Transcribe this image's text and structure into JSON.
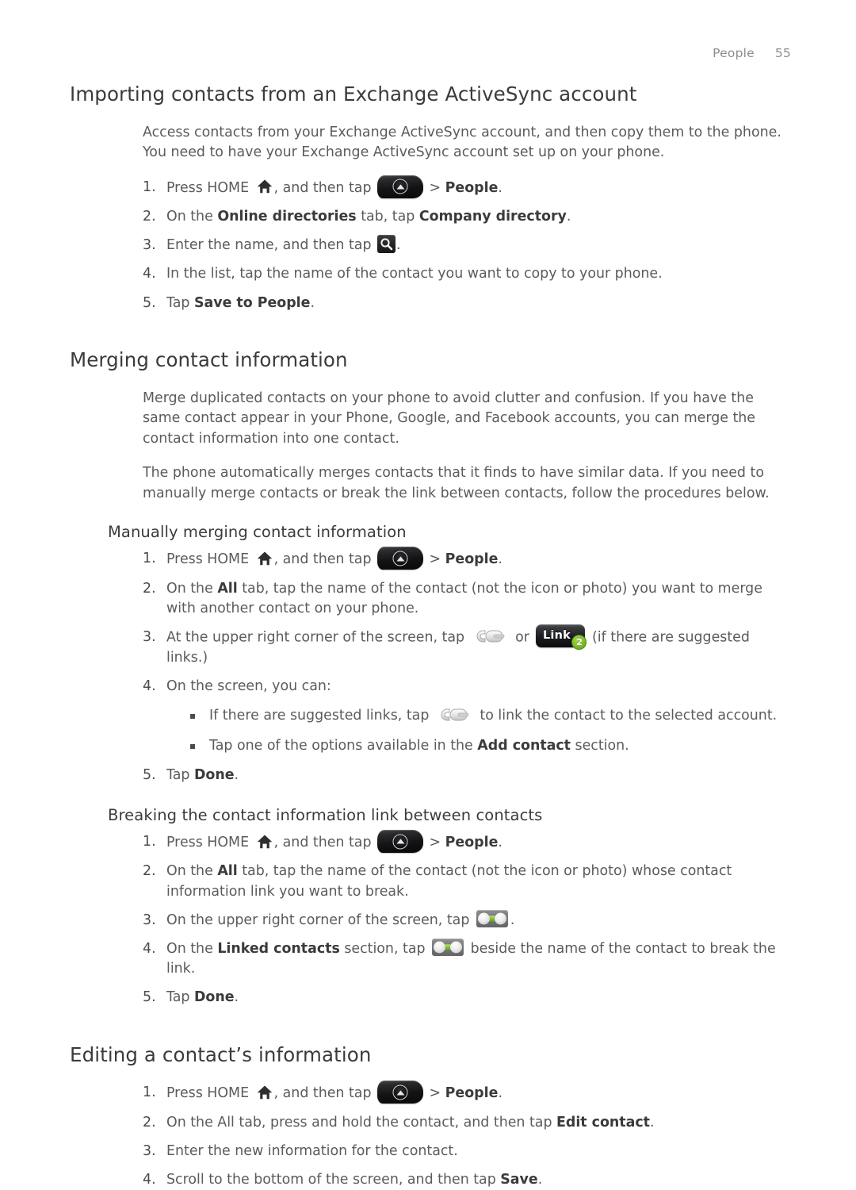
{
  "header": {
    "title": "People",
    "page_number": "55"
  },
  "sections": [
    {
      "id": "importing",
      "heading": "Importing contacts from an Exchange ActiveSync account",
      "paragraphs": [
        "Access contacts from your Exchange ActiveSync account, and then copy them to the phone. You need to have your Exchange ActiveSync account set up on your phone."
      ],
      "steps": [
        {
          "n": "1.",
          "pre": "Press HOME ",
          "icon": "home-icon",
          "mid": ", and then tap ",
          "icon2": "launcher-icon",
          "post": " > ",
          "bold": "People",
          "tail": "."
        },
        {
          "n": "2.",
          "pre": "On the ",
          "bold": "Online directories",
          "mid": " tab, tap ",
          "bold2": "Company directory",
          "tail": "."
        },
        {
          "n": "3.",
          "pre": "Enter the name, and then tap ",
          "icon": "search-icon",
          "tail": "."
        },
        {
          "n": "4.",
          "pre": "In the list, tap the name of the contact you want to copy to your phone."
        },
        {
          "n": "5.",
          "pre": "Tap ",
          "bold": "Save to People",
          "tail": "."
        }
      ]
    },
    {
      "id": "merging",
      "heading": "Merging contact information",
      "paragraphs": [
        "Merge duplicated contacts on your phone to avoid clutter and confusion. If you have the same contact appear in your Phone, Google, and Facebook accounts, you can merge the contact information into one contact.",
        "The phone automatically merges contacts that it finds to have similar data. If you need to manually merge contacts or break the link between contacts, follow the procedures below."
      ],
      "subsections": [
        {
          "id": "manual-merge",
          "heading": "Manually merging contact information",
          "steps": [
            {
              "n": "1.",
              "pre": "Press HOME ",
              "icon": "home-icon",
              "mid": ", and then tap ",
              "icon2": "launcher-icon",
              "post": " > ",
              "bold": "People",
              "tail": "."
            },
            {
              "n": "2.",
              "pre": "On the ",
              "bold": "All",
              "mid": " tab, tap the name of the contact (not the icon or photo) you want to merge with another contact on your phone."
            },
            {
              "n": "3.",
              "pre": "At the upper right corner of the screen, tap ",
              "icon": "link-grey-icon",
              "mid": " or ",
              "icon2": "link-button-icon",
              "post": " (if there are suggested links.)"
            },
            {
              "n": "4.",
              "pre": "On the screen, you can:",
              "bullets": [
                {
                  "pre": "If there are suggested links, tap ",
                  "icon": "link-grey-icon",
                  "post": " to link the contact to the selected account."
                },
                {
                  "pre": "Tap one of the options available in the ",
                  "bold": "Add contact",
                  "post": " section."
                }
              ]
            },
            {
              "n": "5.",
              "pre": "Tap ",
              "bold": "Done",
              "tail": "."
            }
          ]
        },
        {
          "id": "breaking-link",
          "heading": "Breaking the contact information link between contacts",
          "steps": [
            {
              "n": "1.",
              "pre": "Press HOME ",
              "icon": "home-icon",
              "mid": ", and then tap ",
              "icon2": "launcher-icon",
              "post": " > ",
              "bold": "People",
              "tail": "."
            },
            {
              "n": "2.",
              "pre": "On the ",
              "bold": "All",
              "mid": " tab, tap the name of the contact (not the icon or photo) whose contact information link you want to break."
            },
            {
              "n": "3.",
              "pre": "On the upper right corner of the screen, tap ",
              "icon": "break-link-icon",
              "tail": "."
            },
            {
              "n": "4.",
              "pre": "On the ",
              "bold": "Linked contacts",
              "mid": " section, tap ",
              "icon2": "break-link-icon",
              "post": " beside the name of the contact to break the link."
            },
            {
              "n": "5.",
              "pre": "Tap ",
              "bold": "Done",
              "tail": "."
            }
          ]
        }
      ]
    },
    {
      "id": "editing",
      "heading": "Editing a contact’s information",
      "steps": [
        {
          "n": "1.",
          "pre": "Press HOME ",
          "icon": "home-icon",
          "mid": ", and then tap ",
          "icon2": "launcher-icon",
          "post": " > ",
          "bold": "People",
          "tail": "."
        },
        {
          "n": "2.",
          "pre": "On the All tab, press and hold the contact, and then tap ",
          "bold": "Edit contact",
          "tail": "."
        },
        {
          "n": "3.",
          "pre": "Enter the new information for the contact."
        },
        {
          "n": "4.",
          "pre": "Scroll to the bottom of the screen, and then tap ",
          "bold": "Save",
          "tail": "."
        }
      ]
    }
  ],
  "icons": {
    "link_button_label": "Link",
    "link_button_badge": "2"
  },
  "colors": {
    "text": "#5b5b5b",
    "heading": "#3b3b3b",
    "header_grey": "#8d8d8d",
    "badge_green": "#7bbf2a",
    "break_bar_green": "#82c22c"
  }
}
